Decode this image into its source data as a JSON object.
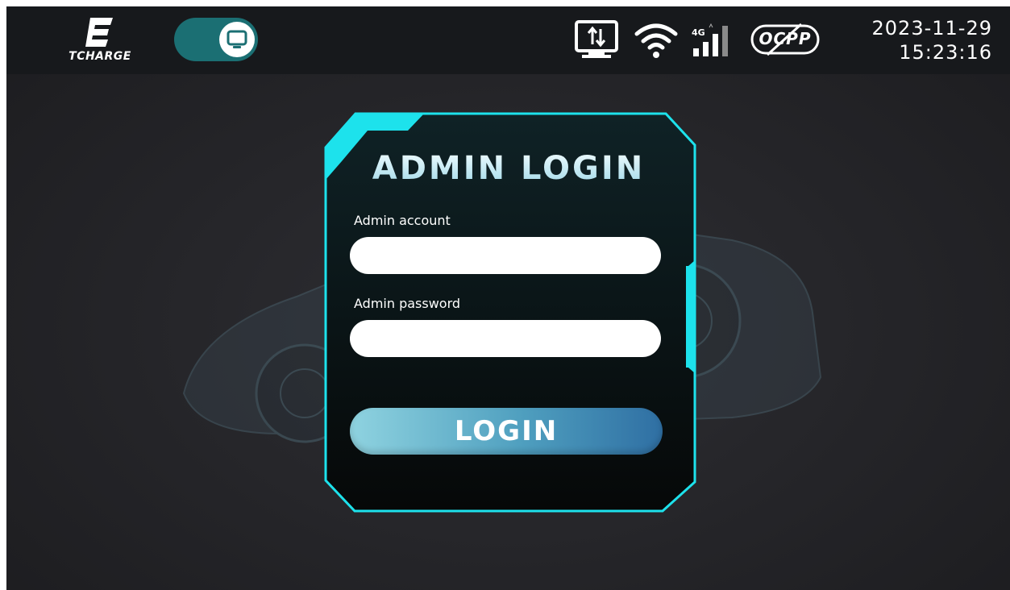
{
  "brand": {
    "logo_text": "TCHARGE",
    "accent": "#1de2ec"
  },
  "statusbar": {
    "date": "2023-11-29",
    "time": "15:23:16",
    "icons": [
      "ethernet-icon",
      "wifi-icon",
      "cellular-4g-icon",
      "ocpp-disconnected-icon"
    ],
    "cell_label": "4G",
    "ocpp_label": "OCPP"
  },
  "toggle": {
    "state": "on",
    "icon": "monitor-icon"
  },
  "login": {
    "title": "ADMIN LOGIN",
    "account_label": "Admin account",
    "account_value": "",
    "password_label": "Admin password",
    "password_value": "",
    "button_label": "LOGIN"
  }
}
